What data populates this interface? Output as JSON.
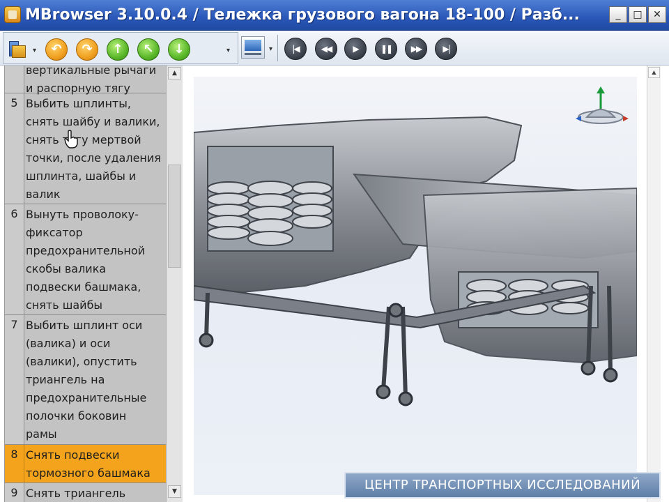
{
  "window": {
    "title": "MBrowser 3.10.0.4 / Тележка грузового вагона 18-100  /  Разб...",
    "controls": [
      "minimize",
      "maximize",
      "close"
    ]
  },
  "toolbar": {
    "left_icons": [
      "model-cube-icon",
      "undo-icon",
      "redo-icon",
      "arrow-up-icon",
      "arrow-up-left-icon",
      "arrow-down-icon"
    ],
    "playback": [
      "skip-to-start",
      "rewind",
      "play",
      "pause",
      "fast-forward",
      "skip-to-end"
    ]
  },
  "steps": [
    {
      "num": "",
      "text": "вертикальные рычаги\nи распорную тягу",
      "selected": false
    },
    {
      "num": "5",
      "text": "Выбить шплинты,\nснять шайбу и валики,\nснять тягу мертвой\nточки, после удаления\nшплинта, шайбы и\nвалик",
      "selected": false
    },
    {
      "num": "6",
      "text": "Вынуть проволоку-\nфиксатор\nпредохранительной\nскобы валика\nподвески башмака,\nснять шайбы",
      "selected": false
    },
    {
      "num": "7",
      "text": "Выбить шплинт оси\n(валика) и оси\n(валики), опустить\nтриангель на\nпредохранительные\nполочки боковин\nрамы",
      "selected": false
    },
    {
      "num": "8",
      "text": "Снять подвески\nтормозного башмака",
      "selected": true
    },
    {
      "num": "9",
      "text": "Снять триангель",
      "selected": false
    }
  ],
  "footer": {
    "banner": "ЦЕНТР ТРАНСПОРТНЫХ ИССЛЕДОВАНИЙ"
  },
  "colors": {
    "title_bar": "#2a57b8",
    "selected_row": "#f4a41c",
    "list_bg": "#c3c3c3",
    "banner": "#6d8ab0"
  }
}
